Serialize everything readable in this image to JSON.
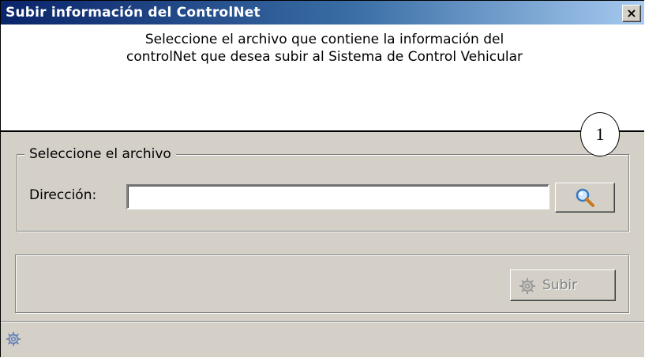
{
  "window": {
    "title": "Subir información del ControlNet",
    "close_glyph": "×"
  },
  "message": {
    "text": "Seleccione el archivo que contiene la información del controlNet que desea subir al Sistema de Control Vehicular"
  },
  "file_group": {
    "legend": "Seleccione el archivo",
    "address_label": "Dirección:",
    "address_value": "",
    "browse_icon": "magnifier-icon"
  },
  "actions": {
    "submit_label": "Subir",
    "submit_icon": "gear-icon",
    "submit_enabled": false
  },
  "statusbar": {
    "icon": "gear-icon"
  },
  "annotation": {
    "label": "1"
  },
  "colors": {
    "titlebar_start": "#0a246a",
    "titlebar_end": "#a6caf0",
    "window_face": "#d4d0c8",
    "disabled_text": "#808080"
  }
}
